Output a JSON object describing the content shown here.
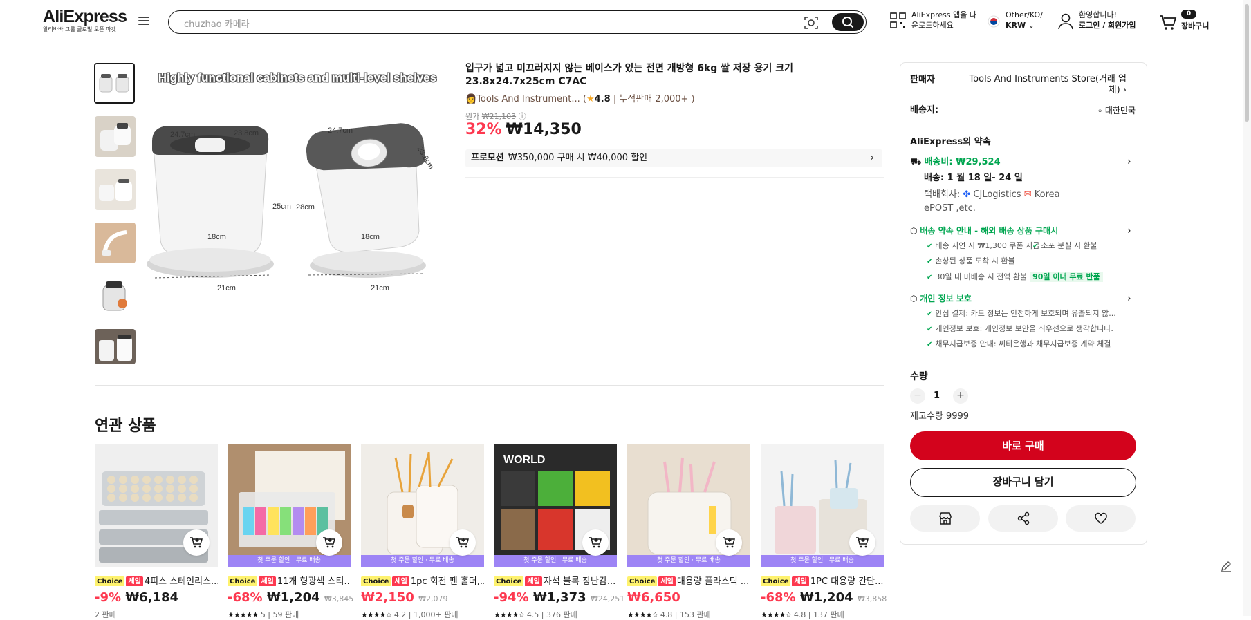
{
  "header": {
    "brand": "AliExpress",
    "brand_tag": "알리바바 그룹 글로벌 오픈 마켓",
    "search_placeholder": "chuzhao 카메라",
    "app_line1": "AliExpress 앱을 다",
    "app_line2": "운로드하세요",
    "region_line1": "Other/KO/",
    "region_line2": "KRW",
    "account_line1": "환영합니다!",
    "account_line2": "로그인 / 회원가입",
    "cart_count": "0",
    "cart_label": "장바구니"
  },
  "product": {
    "title": "입구가 넓고 미끄러지지 않는 베이스가 있는 전면 개방형 6kg 쌀 저장 용기 크기 23.8x24.7x25cm C7AC",
    "store": "Tools And Instrument... (",
    "rating": "4.8",
    "sold": "| 누적판매 2,000+ )",
    "orig_label": "원가",
    "orig_price": "₩21,103",
    "discount": "32%",
    "price": "₩14,350",
    "promo_label": "프로모션",
    "promo_text": "₩350,000 구매 시 ₩40,000 할인",
    "image_banner": "Highly functional cabinets and multi-level shelves",
    "dims": [
      "24.7cm",
      "23.8cm",
      "24.7cm",
      "23.8cm",
      "25cm",
      "28cm",
      "18cm",
      "18cm",
      "21cm",
      "21cm"
    ]
  },
  "panel": {
    "seller_label": "판매자",
    "seller_name": "Tools And Instruments Store(거래 업체)",
    "ship_to_label": "배송지:",
    "ship_to": "대한민국",
    "promise_title": "AliExpress의 약속",
    "shipping_fee": "배송비: ₩29,524",
    "delivery": "배송: 1 월 18 일- 24 일",
    "courier_label": "택배회사:",
    "courier1": "CJLogistics",
    "courier2": "Korea",
    "courier3": "ePOST ,etc.",
    "guarantee_title": "배송 약속 안내 - 해외 배송 상품 구매시",
    "g1": "배송 지연 시 ₩1,300 쿠폰 지급",
    "g2": "소포 분실 시 환불",
    "g3": "손상된 상품 도착 시 환불",
    "g4": "30일 내 미배송 시 전액 환불",
    "g4_badge": "90일 이내 무료 반품",
    "privacy_title": "개인 정보 보호",
    "p1": "안심 결제: 카드 정보는 안전하게 보호되며 유출되지 않...",
    "p2": "개인정보 보호: 개인정보 보안을 최우선으로 생각합니다.",
    "p3": "채무지급보증 안내: 씨티은행과 채무지급보증 계약 체결",
    "qty_label": "수량",
    "qty": "1",
    "stock": "재고수량 9999",
    "buy_now": "바로 구매",
    "add_cart": "장바구니 담기"
  },
  "related": {
    "title": "연관 상품",
    "chip_choice": "Choice",
    "chip_sale": "세일",
    "strip_text": "첫 주문 할인 · 무료 배송",
    "items": [
      {
        "title": "4피스 스테인리스...",
        "discount": "-9%",
        "price": "₩6,184",
        "orig": "",
        "stars": "",
        "meta": "2 판매"
      },
      {
        "title": "11개 형광색 스티...",
        "discount": "-68%",
        "price": "₩1,204",
        "orig": "₩3,845",
        "stars": "★★★★★",
        "meta": "5 | 59 판매"
      },
      {
        "title": "1pc 회전 펜 홀더,...",
        "discount": "",
        "price": "₩2,150",
        "orig": "₩2,079",
        "stars": "★★★★☆",
        "meta": "4.2 | 1,000+ 판매"
      },
      {
        "title": "자석 블록 장난감...",
        "discount": "-94%",
        "price": "₩1,373",
        "orig": "₩24,251",
        "stars": "★★★★☆",
        "meta": "4.5 | 376 판매"
      },
      {
        "title": "대용량 플라스틱 ...",
        "discount": "",
        "price": "₩6,650",
        "orig": "",
        "stars": "★★★★☆",
        "meta": "4.8 | 153 판매"
      },
      {
        "title": "1PC 대용량 간단...",
        "discount": "-68%",
        "price": "₩1,204",
        "orig": "₩3,858",
        "stars": "★★★★☆",
        "meta": "4.8 | 137 판매"
      }
    ]
  },
  "colors": {
    "sale_red": "#fd384f",
    "buy_red": "#d3031c",
    "green": "#00a650",
    "strip_purple": "#9d84f5"
  }
}
